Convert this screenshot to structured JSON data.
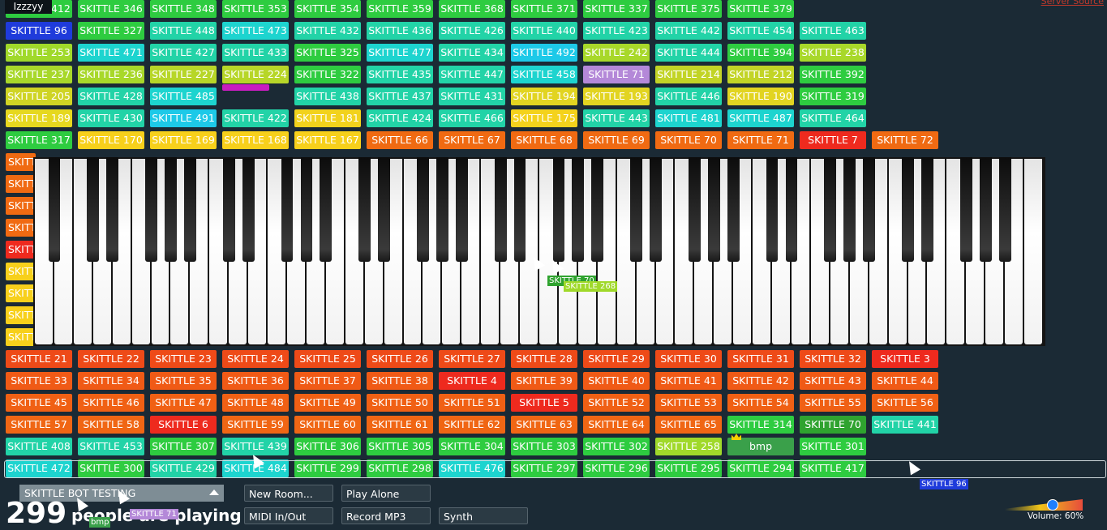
{
  "top_name": "Izzzyy",
  "server_source_label": "Server Source",
  "rows": [
    [
      "SKITTLE 412|#2ecc40",
      "SKITTLE 346|#2ecc40",
      "SKITTLE 348|#2ecc40",
      "SKITTLE 353|#2ecc40",
      "SKITTLE 354|#2ecc40",
      "SKITTLE 359|#2ecc40",
      "SKITTLE 368|#2ecc40",
      "SKITTLE 371|#2ecc40",
      "SKITTLE 337|#2ecc40",
      "SKITTLE 375|#2ecc40",
      "SKITTLE 379|#2ecc40"
    ],
    [
      "SKITTLE 96|#1f3bdb",
      "SKITTLE 327|#2ecc40",
      "SKITTLE 448|#22d3a7",
      "SKITTLE 473|#1dd4cf",
      "SKITTLE 432|#22d3a7",
      "SKITTLE 436|#22d3a7",
      "SKITTLE 426|#22d3a7",
      "SKITTLE 440|#22d3a7",
      "SKITTLE 423|#22d3a7",
      "SKITTLE 442|#22d3a7",
      "SKITTLE 454|#22d3a7",
      "SKITTLE 463|#22d3a7"
    ],
    [
      "SKITTLE 253|#a0d92a",
      "SKITTLE 471|#1dd4cf",
      "SKITTLE 427|#22d3a7",
      "SKITTLE 433|#22d3a7",
      "SKITTLE 325|#2ecc40",
      "SKITTLE 477|#1dd4cf",
      "SKITTLE 434|#22d3a7",
      "SKITTLE 492|#1dc9e8",
      "SKITTLE 242|#a8d82a",
      "SKITTLE 444|#22d3a7",
      "SKITTLE 394|#2ecc40",
      "SKITTLE 238|#a8d82a"
    ],
    [
      "SKITTLE 237|#a8d82a",
      "SKITTLE 236|#a8d82a",
      "SKITTLE 227|#b7d628",
      "SKITTLE 224|#b7d628",
      "SKITTLE 322|#2ecc40",
      "SKITTLE 435|#22d3a7",
      "SKITTLE 447|#22d3a7",
      "SKITTLE 458|#1dd4cf",
      "SKITTLE 71|#b488d8",
      "SKITTLE 214|#c2d426",
      "SKITTLE 212|#c2d426",
      "SKITTLE 392|#2ecc40"
    ],
    [
      "SKITTLE 205|#cfd424",
      "SKITTLE 428|#22d3a7",
      "SKITTLE 485|#1dd4cf",
      "|gap",
      "SKITTLE 438|#22d3a7",
      "SKITTLE 437|#22d3a7",
      "SKITTLE 431|#22d3a7",
      "SKITTLE 194|#e2d421",
      "SKITTLE 193|#e2d421",
      "SKITTLE 446|#22d3a7",
      "SKITTLE 190|#e2d421",
      "SKITTLE 319|#2ecc40"
    ],
    [
      "SKITTLE 189|#e6d81f",
      "SKITTLE 430|#22d3a7",
      "SKITTLE 491|#1dc9e8",
      "SKITTLE 422|#22d3a7",
      "SKITTLE 181|#f2d21c",
      "SKITTLE 424|#22d3a7",
      "SKITTLE 466|#22d3a7",
      "SKITTLE 175|#f4d21c",
      "SKITTLE 443|#22d3a7",
      "SKITTLE 481|#1dd4cf",
      "SKITTLE 487|#1dd4cf",
      "SKITTLE 464|#22d3a7"
    ],
    [
      "SKITTLE 317|#2ecc40",
      "SKITTLE 170|#f7d01b",
      "SKITTLE 169|#f7d01b",
      "SKITTLE 168|#f7d01b",
      "SKITTLE 167|#f7d01b",
      "SKITTLE 66|#f06a12",
      "SKITTLE 67|#f06a12",
      "SKITTLE 68|#f06a12",
      "SKITTLE 69|#f06a12",
      "SKITTLE 70|#f06a12",
      "SKITTLE 71|#f06a12",
      "SKITTLE 7|#ee2a1e",
      "SKITTLE 72|#f06a12"
    ],
    [
      "SKITTLE 21|#ee4a18",
      "SKITTLE 22|#ee4a18",
      "SKITTLE 23|#ee4a18",
      "SKITTLE 24|#ee4a18",
      "SKITTLE 25|#ee4a18",
      "SKITTLE 26|#ee4a18",
      "SKITTLE 27|#ee4a18",
      "SKITTLE 28|#ee4a18",
      "SKITTLE 29|#ee4a18",
      "SKITTLE 30|#ee4a18",
      "SKITTLE 31|#ee4a18",
      "SKITTLE 32|#ee4a18",
      "SKITTLE 3|#ee2a1e"
    ],
    [
      "SKITTLE 33|#f05a16",
      "SKITTLE 34|#f05a16",
      "SKITTLE 35|#f05a16",
      "SKITTLE 36|#f05a16",
      "SKITTLE 37|#f05a16",
      "SKITTLE 38|#f05a16",
      "SKITTLE 4|#ee2a1e",
      "SKITTLE 39|#f05a16",
      "SKITTLE 40|#f05a16",
      "SKITTLE 41|#f05a16",
      "SKITTLE 42|#f05a16",
      "SKITTLE 43|#f05a16",
      "SKITTLE 44|#f05a16"
    ],
    [
      "SKITTLE 45|#f06014",
      "SKITTLE 46|#f06014",
      "SKITTLE 47|#f06014",
      "SKITTLE 48|#f06014",
      "SKITTLE 49|#f06014",
      "SKITTLE 50|#f06014",
      "SKITTLE 51|#f06014",
      "SKITTLE 5|#ee2a1e",
      "SKITTLE 52|#f06014",
      "SKITTLE 53|#f06014",
      "SKITTLE 54|#f06014",
      "SKITTLE 55|#f06014",
      "SKITTLE 56|#f06014"
    ],
    [
      "SKITTLE 57|#f06614",
      "SKITTLE 58|#f06614",
      "SKITTLE 6|#ee2a1e",
      "SKITTLE 59|#f06614",
      "SKITTLE 60|#f06614",
      "SKITTLE 61|#f06614",
      "SKITTLE 62|#f06614",
      "SKITTLE 63|#f06614",
      "SKITTLE 64|#f06614",
      "SKITTLE 65|#f06614",
      "SKITTLE 314|#2ecc40",
      "SKITTLE 70|#2fa32f",
      "SKITTLE 441|#22d3a7"
    ],
    [
      "SKITTLE 408|#22d3a7",
      "SKITTLE 453|#22d3a7",
      "SKITTLE 307|#2ecc40",
      "SKITTLE 439|#22d3a7",
      "SKITTLE 306|#2ecc40",
      "SKITTLE 305|#2ecc40",
      "SKITTLE 304|#2ecc40",
      "SKITTLE 303|#2ecc40",
      "SKITTLE 302|#2ecc40",
      "SKITTLE 258|#a0d92a",
      "bmp|#3aa04a",
      "SKITTLE 301|#2ecc40"
    ],
    [
      "SKITTLE 472|#1dd4cf",
      "SKITTLE 300|#2ecc40",
      "SKITTLE 429|#22d3a7",
      "SKITTLE 484|#1dd4cf",
      "SKITTLE 299|#2ecc40",
      "SKITTLE 298|#2ecc40",
      "SKITTLE 476|#1dd4cf",
      "SKITTLE 297|#2ecc40",
      "SKITTLE 296|#2ecc40",
      "SKITTLE 295|#2ecc40",
      "SKITTLE 294|#2ecc40",
      "SKITTLE 417|#2ecc40"
    ]
  ],
  "left_stubs": [
    "SKITT|#f06a12",
    "SKITT|#f06a12",
    "SKITT|#f06a12",
    "SKITT|#f06a12",
    "SKITT|#ee2a1e",
    "SKITT|#f7d01b",
    "SKITT|#f7d01b",
    "SKITT|#f7d01b",
    "SKITT|#f7d01b"
  ],
  "piano_cursor_tags": [
    {
      "label": "SKITTLE 70",
      "color": "#2fa32f"
    },
    {
      "label": "SKITTLE 268",
      "color": "#a0d92a"
    }
  ],
  "floating_tag": {
    "label": "SKITTLE 96",
    "color": "#1f3bdb"
  },
  "bottom": {
    "room_name": "SKITTLE BOT TESTING",
    "new_room": "New Room...",
    "play_alone": "Play Alone",
    "midi": "MIDI In/Out",
    "record": "Record MP3",
    "synth": "Synth",
    "player_count": "299",
    "count_label": "people are playing",
    "cursor_tags": [
      {
        "label": "SKITTLE 71",
        "color": "#b488d8"
      },
      {
        "label": "bmp",
        "color": "#3aa04a"
      }
    ],
    "volume_label": "Volume: 60%",
    "volume_value": 0.6
  }
}
